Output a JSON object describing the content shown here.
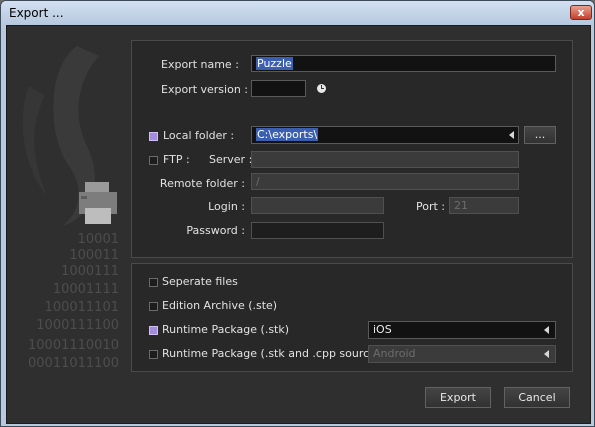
{
  "window": {
    "title": "Export ...",
    "close_symbol": "x"
  },
  "decoration": {
    "binary_lines": [
      "10001",
      "100011",
      "1000111",
      "10001111",
      "100011101",
      "1000111100",
      "10001110010",
      "00011011100"
    ]
  },
  "top_panel": {
    "export_name_label": "Export name :",
    "export_name_value": "Puzzle",
    "export_version_label": "Export version :",
    "export_version_value": "",
    "local_folder": {
      "label": "Local folder :",
      "checked": true,
      "value": "C:\\exports\\",
      "browse_label": "..."
    },
    "ftp": {
      "label": "FTP :",
      "checked": false,
      "server_label": "Server :",
      "server_value": "",
      "remote_folder_label": "Remote folder :",
      "remote_folder_value": "/",
      "login_label": "Login :",
      "login_value": "",
      "port_label": "Port :",
      "port_value": "21",
      "password_label": "Password :",
      "password_value": ""
    }
  },
  "bottom_panel": {
    "separate_files": {
      "label": "Seperate files",
      "checked": false
    },
    "edition_archive": {
      "label": "Edition Archive (.ste)",
      "checked": false
    },
    "runtime_package": {
      "label": "Runtime Package (.stk)",
      "checked": true,
      "platform": "iOS"
    },
    "runtime_package_source": {
      "label": "Runtime Package (.stk and .cpp source)",
      "checked": false,
      "platform": "Android"
    }
  },
  "buttons": {
    "export": "Export",
    "cancel": "Cancel"
  },
  "colors": {
    "accent_check": "#a58bdd",
    "selection": "#3b5fb0",
    "background": "#2f2f2f"
  }
}
